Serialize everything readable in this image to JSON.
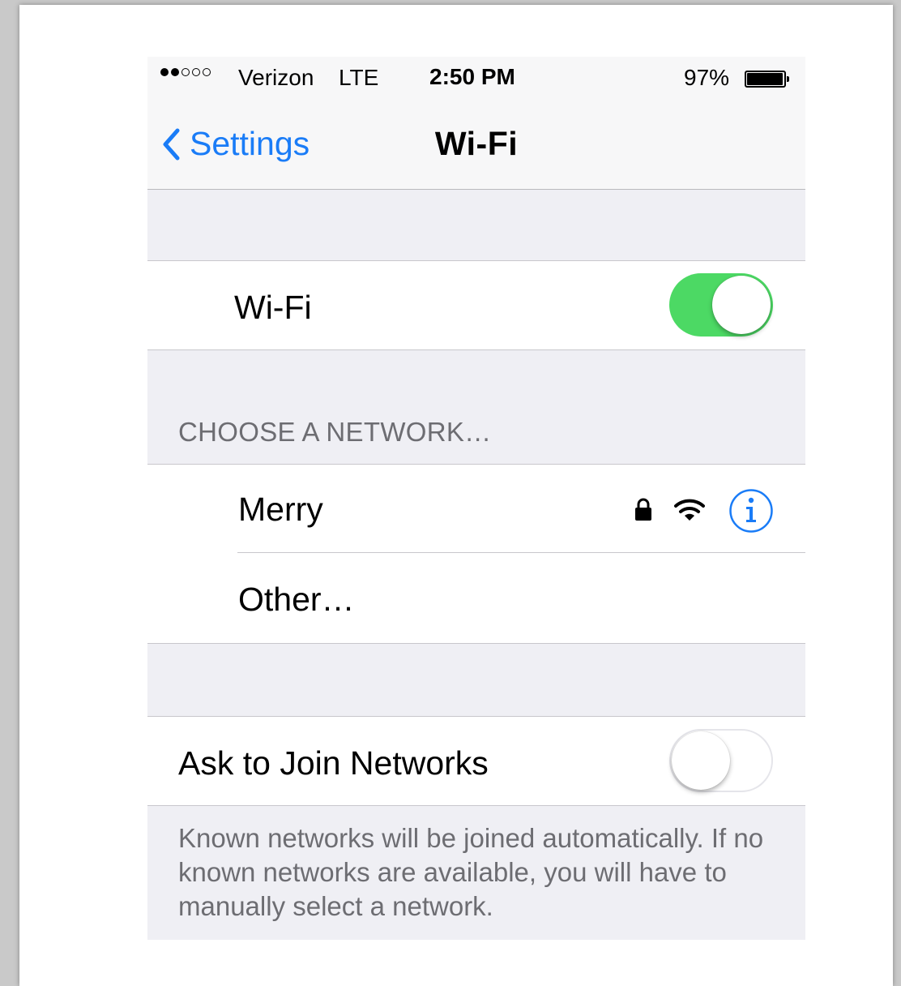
{
  "status_bar": {
    "signal_bars_filled": 2,
    "signal_bars_total": 5,
    "carrier": "Verizon",
    "network_type": "LTE",
    "time": "2:50 PM",
    "battery_percent_label": "97%",
    "battery_level": 0.97
  },
  "nav": {
    "back_label": "Settings",
    "title": "Wi-Fi"
  },
  "wifi_row": {
    "label": "Wi-Fi",
    "enabled": true
  },
  "networks_section": {
    "header": "CHOOSE A NETWORK…",
    "items": [
      {
        "name": "Merry",
        "secured": true,
        "icons": [
          "lock-icon",
          "wifi-signal-icon",
          "info-icon"
        ]
      },
      {
        "name": "Other…"
      }
    ]
  },
  "ask_to_join": {
    "label": "Ask to Join Networks",
    "enabled": false,
    "footer": "Known networks will be joined automatically. If no known networks are available, you will have to manually select a network."
  },
  "colors": {
    "accent_blue": "#1a7cf7",
    "toggle_green": "#4cd964",
    "group_background": "#efeff4",
    "secondary_text": "#6d6d72"
  }
}
